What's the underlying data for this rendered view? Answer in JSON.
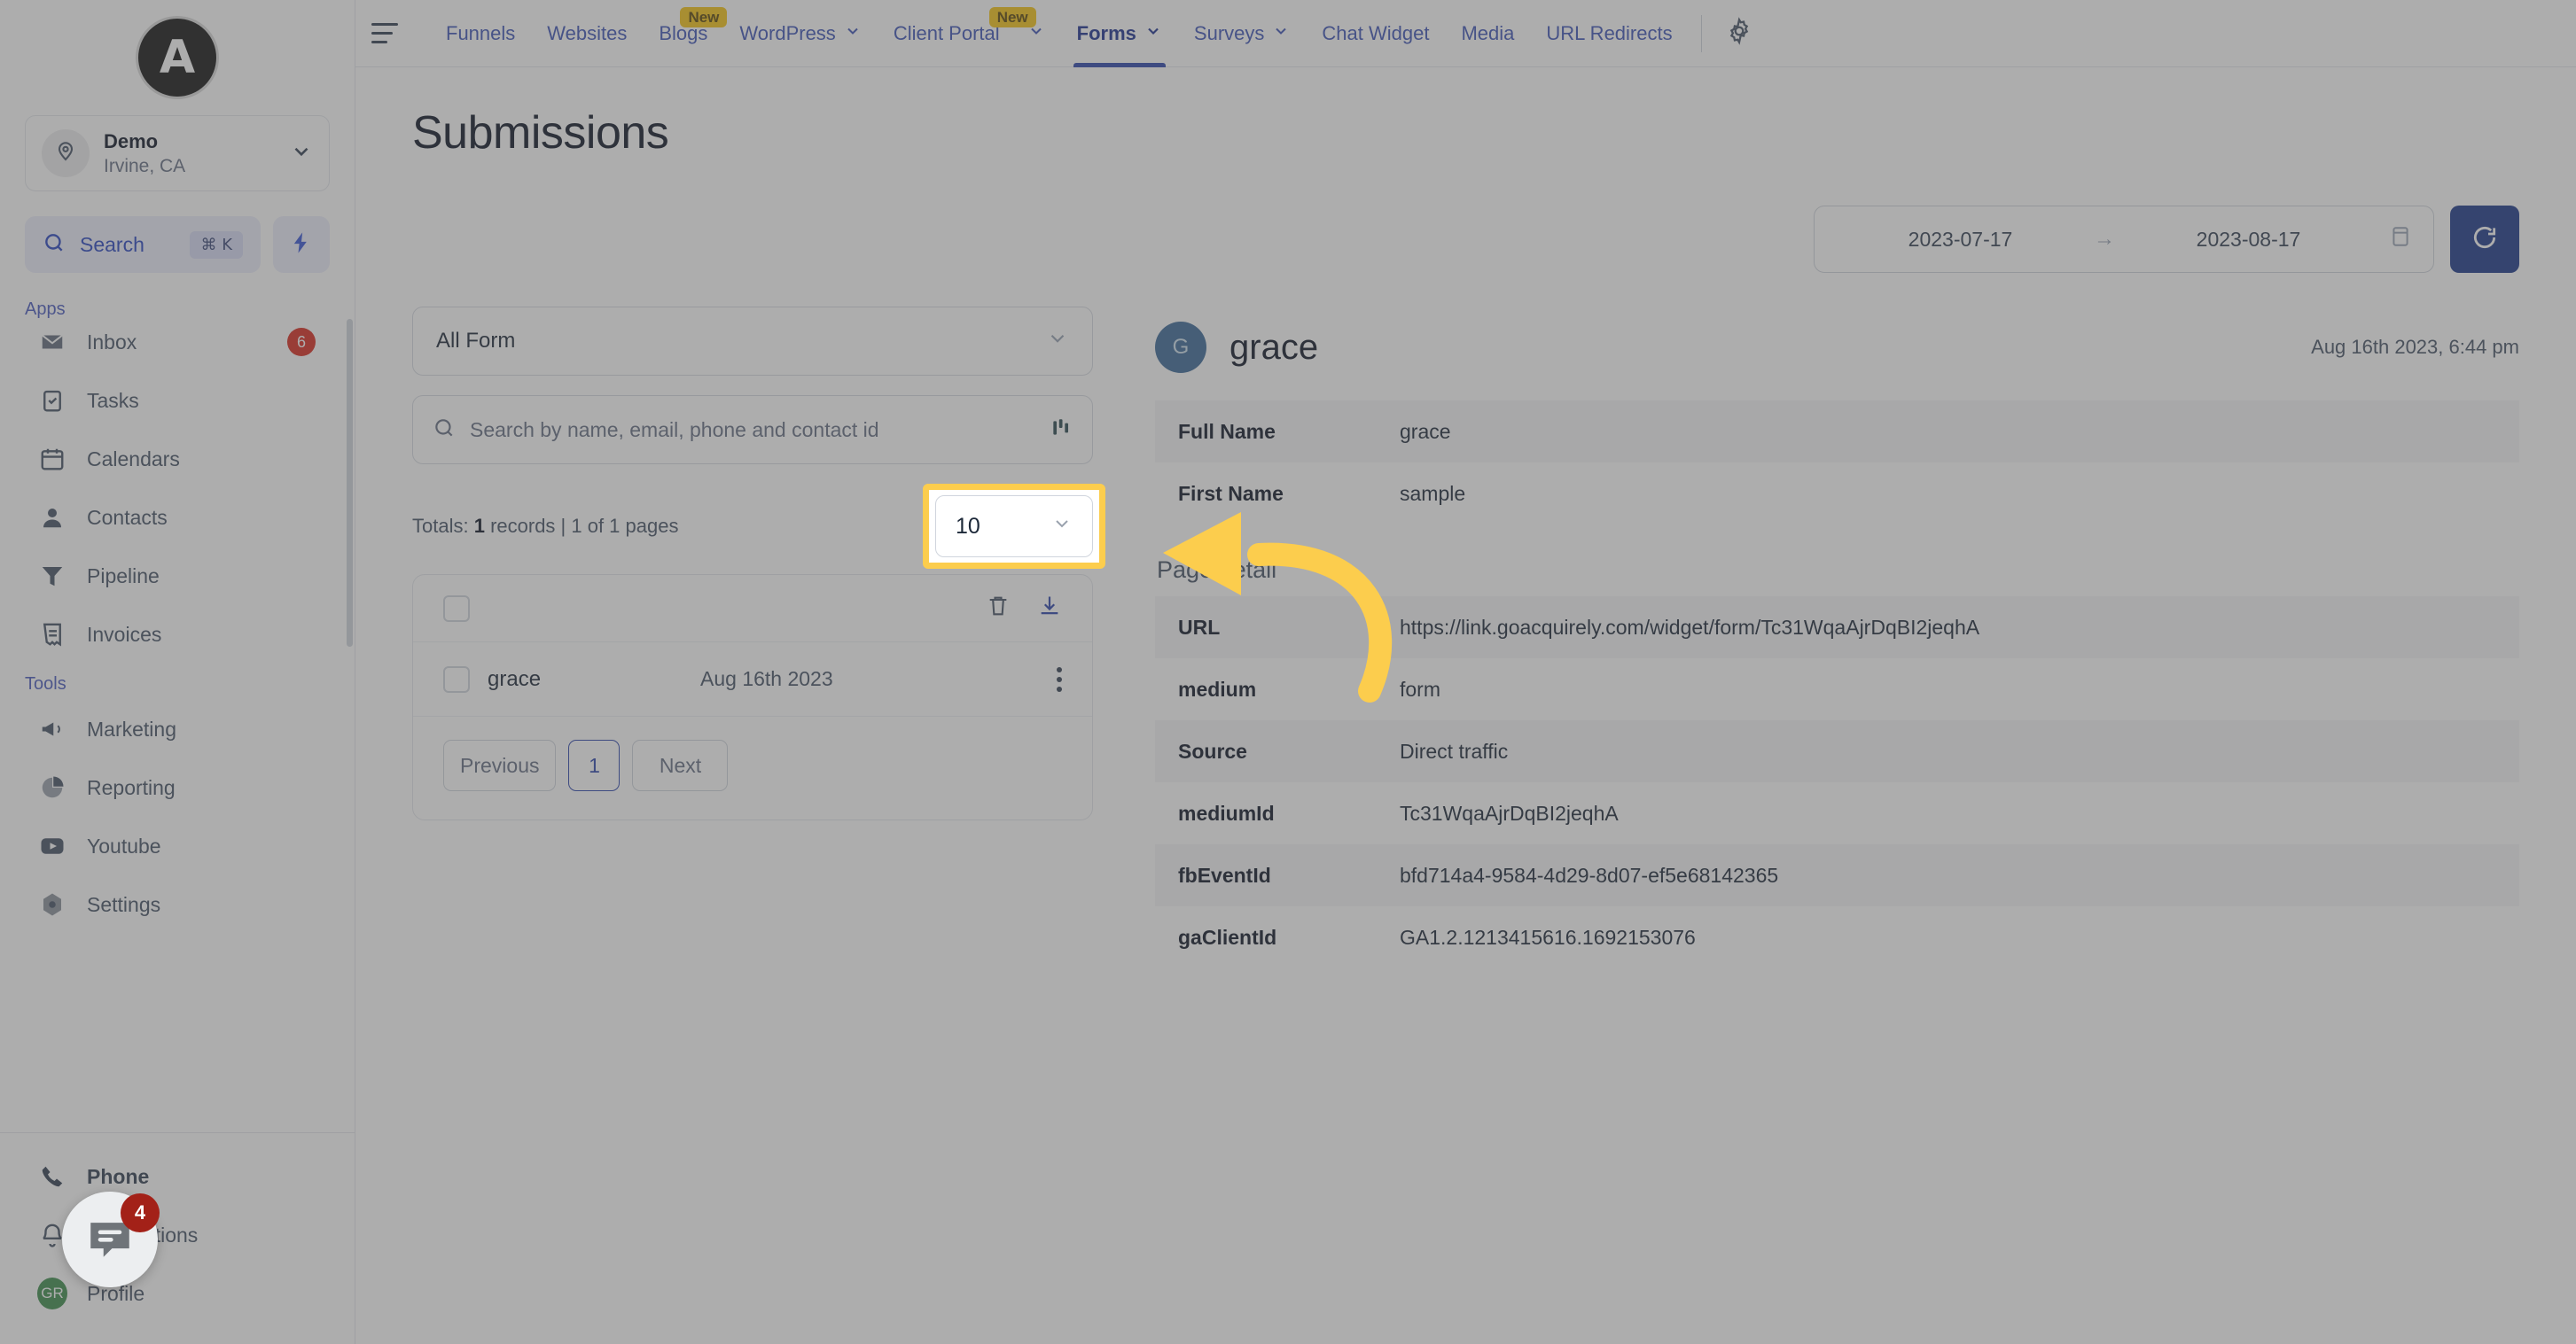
{
  "sidebar": {
    "logo_letter": "A",
    "location": {
      "name": "Demo",
      "sub": "Irvine, CA"
    },
    "search": {
      "label": "Search",
      "shortcut": "⌘ K"
    },
    "groups": [
      {
        "label": "Apps",
        "items": [
          {
            "name": "Inbox",
            "icon": "inbox-icon",
            "badge": "6"
          },
          {
            "name": "Tasks",
            "icon": "tasks-icon",
            "badge": ""
          },
          {
            "name": "Calendars",
            "icon": "calendar-icon",
            "badge": ""
          },
          {
            "name": "Contacts",
            "icon": "contacts-icon",
            "badge": ""
          },
          {
            "name": "Pipeline",
            "icon": "pipeline-icon",
            "badge": ""
          },
          {
            "name": "Invoices",
            "icon": "invoices-icon",
            "badge": ""
          }
        ]
      },
      {
        "label": "Tools",
        "items": [
          {
            "name": "Marketing",
            "icon": "megaphone-icon",
            "badge": ""
          },
          {
            "name": "Reporting",
            "icon": "pie-chart-icon",
            "badge": ""
          },
          {
            "name": "Youtube",
            "icon": "youtube-icon",
            "badge": ""
          },
          {
            "name": "Settings",
            "icon": "settings-icon",
            "badge": ""
          }
        ]
      }
    ],
    "bottom": [
      {
        "name": "Phone",
        "icon": "phone-icon"
      },
      {
        "name": "Notifications",
        "icon": "bell-icon"
      },
      {
        "name": "Profile",
        "icon": "avatar-icon"
      }
    ],
    "profile_initials": "GR"
  },
  "topnav": {
    "tabs": [
      {
        "label": "Funnels",
        "caret": false,
        "badge": "",
        "active": false
      },
      {
        "label": "Websites",
        "caret": false,
        "badge": "",
        "active": false
      },
      {
        "label": "Blogs",
        "caret": false,
        "badge": "New",
        "active": false
      },
      {
        "label": "WordPress",
        "caret": true,
        "badge": "",
        "active": false
      },
      {
        "label": "Client Portal",
        "caret": true,
        "badge": "New",
        "active": false
      },
      {
        "label": "Forms",
        "caret": true,
        "badge": "",
        "active": true
      },
      {
        "label": "Surveys",
        "caret": true,
        "badge": "",
        "active": false
      },
      {
        "label": "Chat Widget",
        "caret": false,
        "badge": "",
        "active": false
      },
      {
        "label": "Media",
        "caret": false,
        "badge": "",
        "active": false
      },
      {
        "label": "URL Redirects",
        "caret": false,
        "badge": "",
        "active": false
      }
    ],
    "settings_icon": "gear-icon"
  },
  "page": {
    "title": "Submissions",
    "date_range": {
      "start": "2023-07-17",
      "end": "2023-08-17",
      "separator": "→"
    },
    "refresh_label": "refresh-icon"
  },
  "left_panel": {
    "form_filter": "All Form",
    "search_placeholder": "Search by name, email, phone and contact id",
    "search_value": "",
    "totals_prefix": "Totals: ",
    "totals_count": "1",
    "totals_suffix": " records | 1 of 1 pages",
    "per_page": "10",
    "rows": [
      {
        "name": "grace",
        "date": "Aug 16th 2023"
      }
    ],
    "pagination": {
      "previous": "Previous",
      "page": "1",
      "next": "Next"
    }
  },
  "detail": {
    "avatar_letter": "G",
    "name": "grace",
    "timestamp": "Aug 16th 2023, 6:44 pm",
    "fields": [
      {
        "key": "Full Name",
        "value": "grace"
      },
      {
        "key": "First Name",
        "value": "sample"
      }
    ],
    "page_detail_title": "Page detail",
    "page_detail": [
      {
        "key": "URL",
        "value": "https://link.goacquirely.com/widget/form/Tc31WqaAjrDqBI2jeqhA"
      },
      {
        "key": "medium",
        "value": "form"
      },
      {
        "key": "Source",
        "value": "Direct traffic"
      },
      {
        "key": "mediumId",
        "value": "Tc31WqaAjrDqBI2jeqhA"
      },
      {
        "key": "fbEventId",
        "value": "bfd714a4-9584-4d29-8d07-ef5e68142365"
      },
      {
        "key": "gaClientId",
        "value": "GA1.2.1213415616.1692153076"
      }
    ]
  },
  "chat_widget": {
    "badge": "4",
    "icon": "chat-bubble-icon"
  },
  "colors": {
    "highlight": "#fccd4d",
    "accent_blue": "#2f47ad",
    "refresh_blue": "#1e3a8a",
    "badge_red": "#d92d20",
    "new_badge": "#f5c518"
  }
}
